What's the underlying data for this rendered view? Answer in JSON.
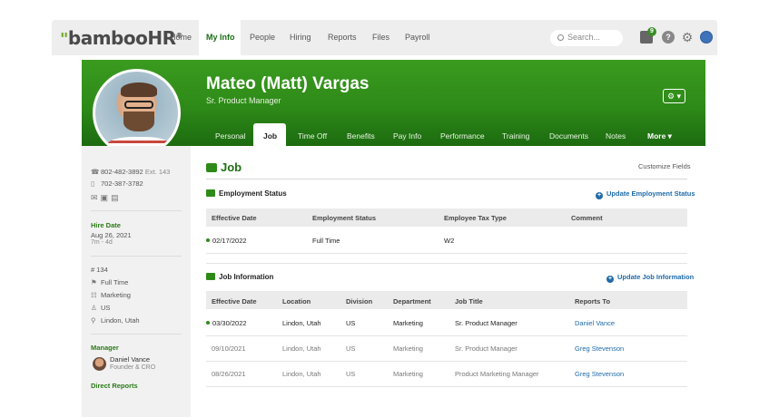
{
  "nav": {
    "logo_main": "bamboo",
    "logo_hr": "HR",
    "logo_mark": "®",
    "items": [
      "Home",
      "My Info",
      "People",
      "Hiring",
      "Reports",
      "Files",
      "Payroll"
    ],
    "active": "My Info",
    "search_placeholder": "Search...",
    "inbox_badge": "9",
    "help_label": "?",
    "settings_label": "⚙"
  },
  "profile": {
    "name": "Mateo (Matt) Vargas",
    "title": "Sr. Product Manager",
    "settings_button": "⚙ ▾"
  },
  "tabs": [
    "Personal",
    "Job",
    "Time Off",
    "Benefits",
    "Pay Info",
    "Performance",
    "Training",
    "Documents",
    "Notes",
    "More ▾"
  ],
  "active_tab": "Job",
  "sidebar": {
    "work_phone": "802-482-3892",
    "work_ext": "Ext. 143",
    "mobile_phone": "702-387-3782",
    "hire_date_label": "Hire Date",
    "hire_date": "Aug 26, 2021",
    "tenure": "7m - 4d",
    "employee_number": "# 134",
    "employment_type": "Full Time",
    "department": "Marketing",
    "division": "US",
    "location": "Lindon, Utah",
    "manager_label": "Manager",
    "manager_name": "Daniel Vance",
    "manager_title": "Founder & CRO",
    "direct_reports_label": "Direct Reports"
  },
  "main": {
    "title": "Job",
    "customize": "Customize Fields",
    "employment_status": {
      "title": "Employment Status",
      "update": "Update Employment Status",
      "columns": [
        "Effective Date",
        "Employment Status",
        "Employee Tax Type",
        "Comment"
      ],
      "rows": [
        {
          "date": "02/17/2022",
          "status": "Full Time",
          "tax": "W2",
          "comment": ""
        }
      ]
    },
    "job_information": {
      "title": "Job Information",
      "update": "Update Job Information",
      "columns": [
        "Effective Date",
        "Location",
        "Division",
        "Department",
        "Job Title",
        "Reports To"
      ],
      "rows": [
        {
          "date": "03/30/2022",
          "location": "Lindon, Utah",
          "division": "US",
          "department": "Marketing",
          "job_title": "Sr. Product Manager",
          "reports_to": "Daniel Vance"
        },
        {
          "date": "09/10/2021",
          "location": "Lindon, Utah",
          "division": "US",
          "department": "Marketing",
          "job_title": "Sr. Product Manager",
          "reports_to": "Greg Stevenson"
        },
        {
          "date": "08/26/2021",
          "location": "Lindon, Utah",
          "division": "US",
          "department": "Marketing",
          "job_title": "Product Marketing Manager",
          "reports_to": "Greg Stevenson"
        }
      ]
    }
  },
  "colors": {
    "brand_green": "#2e8a18",
    "link_blue": "#1f6aa8"
  }
}
